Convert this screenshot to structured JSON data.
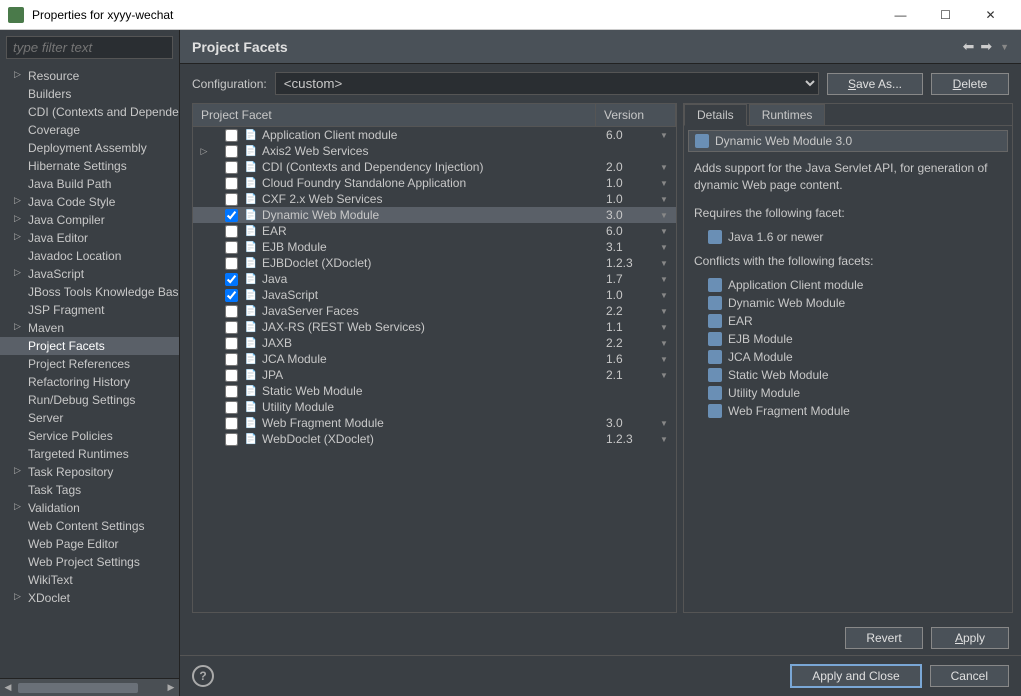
{
  "window": {
    "title": "Properties for xyyy-wechat"
  },
  "filter_placeholder": "type filter text",
  "sidebar": {
    "items": [
      {
        "label": "Resource",
        "children": true
      },
      {
        "label": "Builders"
      },
      {
        "label": "CDI (Contexts and Dependency Injection)"
      },
      {
        "label": "Coverage"
      },
      {
        "label": "Deployment Assembly"
      },
      {
        "label": "Hibernate Settings"
      },
      {
        "label": "Java Build Path"
      },
      {
        "label": "Java Code Style",
        "children": true
      },
      {
        "label": "Java Compiler",
        "children": true
      },
      {
        "label": "Java Editor",
        "children": true
      },
      {
        "label": "Javadoc Location"
      },
      {
        "label": "JavaScript",
        "children": true
      },
      {
        "label": "JBoss Tools Knowledge Base"
      },
      {
        "label": "JSP Fragment"
      },
      {
        "label": "Maven",
        "children": true
      },
      {
        "label": "Project Facets",
        "selected": true
      },
      {
        "label": "Project References"
      },
      {
        "label": "Refactoring History"
      },
      {
        "label": "Run/Debug Settings"
      },
      {
        "label": "Server"
      },
      {
        "label": "Service Policies"
      },
      {
        "label": "Targeted Runtimes"
      },
      {
        "label": "Task Repository",
        "children": true
      },
      {
        "label": "Task Tags"
      },
      {
        "label": "Validation",
        "children": true
      },
      {
        "label": "Web Content Settings"
      },
      {
        "label": "Web Page Editor"
      },
      {
        "label": "Web Project Settings"
      },
      {
        "label": "WikiText"
      },
      {
        "label": "XDoclet",
        "children": true
      }
    ]
  },
  "header": {
    "title": "Project Facets"
  },
  "config": {
    "label": "Configuration:",
    "value": "<custom>",
    "save_as": "Save As...",
    "delete": "Delete"
  },
  "facets": {
    "columns": {
      "name": "Project Facet",
      "version": "Version"
    },
    "rows": [
      {
        "name": "Application Client module",
        "version": "6.0",
        "checked": false,
        "indent": 1
      },
      {
        "name": "Axis2 Web Services",
        "version": "",
        "checked": false,
        "indent": 1,
        "expander": true
      },
      {
        "name": "CDI (Contexts and Dependency Injection)",
        "version": "2.0",
        "checked": false,
        "indent": 1
      },
      {
        "name": "Cloud Foundry Standalone Application",
        "version": "1.0",
        "checked": false,
        "indent": 1
      },
      {
        "name": "CXF 2.x Web Services",
        "version": "1.0",
        "checked": false,
        "indent": 1
      },
      {
        "name": "Dynamic Web Module",
        "version": "3.0",
        "checked": true,
        "indent": 1,
        "selected": true
      },
      {
        "name": "EAR",
        "version": "6.0",
        "checked": false,
        "indent": 1
      },
      {
        "name": "EJB Module",
        "version": "3.1",
        "checked": false,
        "indent": 1
      },
      {
        "name": "EJBDoclet (XDoclet)",
        "version": "1.2.3",
        "checked": false,
        "indent": 1
      },
      {
        "name": "Java",
        "version": "1.7",
        "checked": true,
        "indent": 1
      },
      {
        "name": "JavaScript",
        "version": "1.0",
        "checked": true,
        "indent": 1
      },
      {
        "name": "JavaServer Faces",
        "version": "2.2",
        "checked": false,
        "indent": 1
      },
      {
        "name": "JAX-RS (REST Web Services)",
        "version": "1.1",
        "checked": false,
        "indent": 1
      },
      {
        "name": "JAXB",
        "version": "2.2",
        "checked": false,
        "indent": 1
      },
      {
        "name": "JCA Module",
        "version": "1.6",
        "checked": false,
        "indent": 1
      },
      {
        "name": "JPA",
        "version": "2.1",
        "checked": false,
        "indent": 1
      },
      {
        "name": "Static Web Module",
        "version": "",
        "checked": false,
        "indent": 1
      },
      {
        "name": "Utility Module",
        "version": "",
        "checked": false,
        "indent": 1
      },
      {
        "name": "Web Fragment Module",
        "version": "3.0",
        "checked": false,
        "indent": 1
      },
      {
        "name": "WebDoclet (XDoclet)",
        "version": "1.2.3",
        "checked": false,
        "indent": 1
      }
    ]
  },
  "details": {
    "tabs": {
      "details": "Details",
      "runtimes": "Runtimes"
    },
    "title": "Dynamic Web Module 3.0",
    "description": "Adds support for the Java Servlet API, for generation of dynamic Web page content.",
    "requires_label": "Requires the following facet:",
    "requires": [
      {
        "label": "Java 1.6 or newer"
      }
    ],
    "conflicts_label": "Conflicts with the following facets:",
    "conflicts": [
      {
        "label": "Application Client module"
      },
      {
        "label": "Dynamic Web Module"
      },
      {
        "label": "EAR"
      },
      {
        "label": "EJB Module"
      },
      {
        "label": "JCA Module"
      },
      {
        "label": "Static Web Module"
      },
      {
        "label": "Utility Module"
      },
      {
        "label": "Web Fragment Module"
      }
    ]
  },
  "buttons": {
    "revert": "Revert",
    "apply": "Apply",
    "apply_close": "Apply and Close",
    "cancel": "Cancel"
  }
}
